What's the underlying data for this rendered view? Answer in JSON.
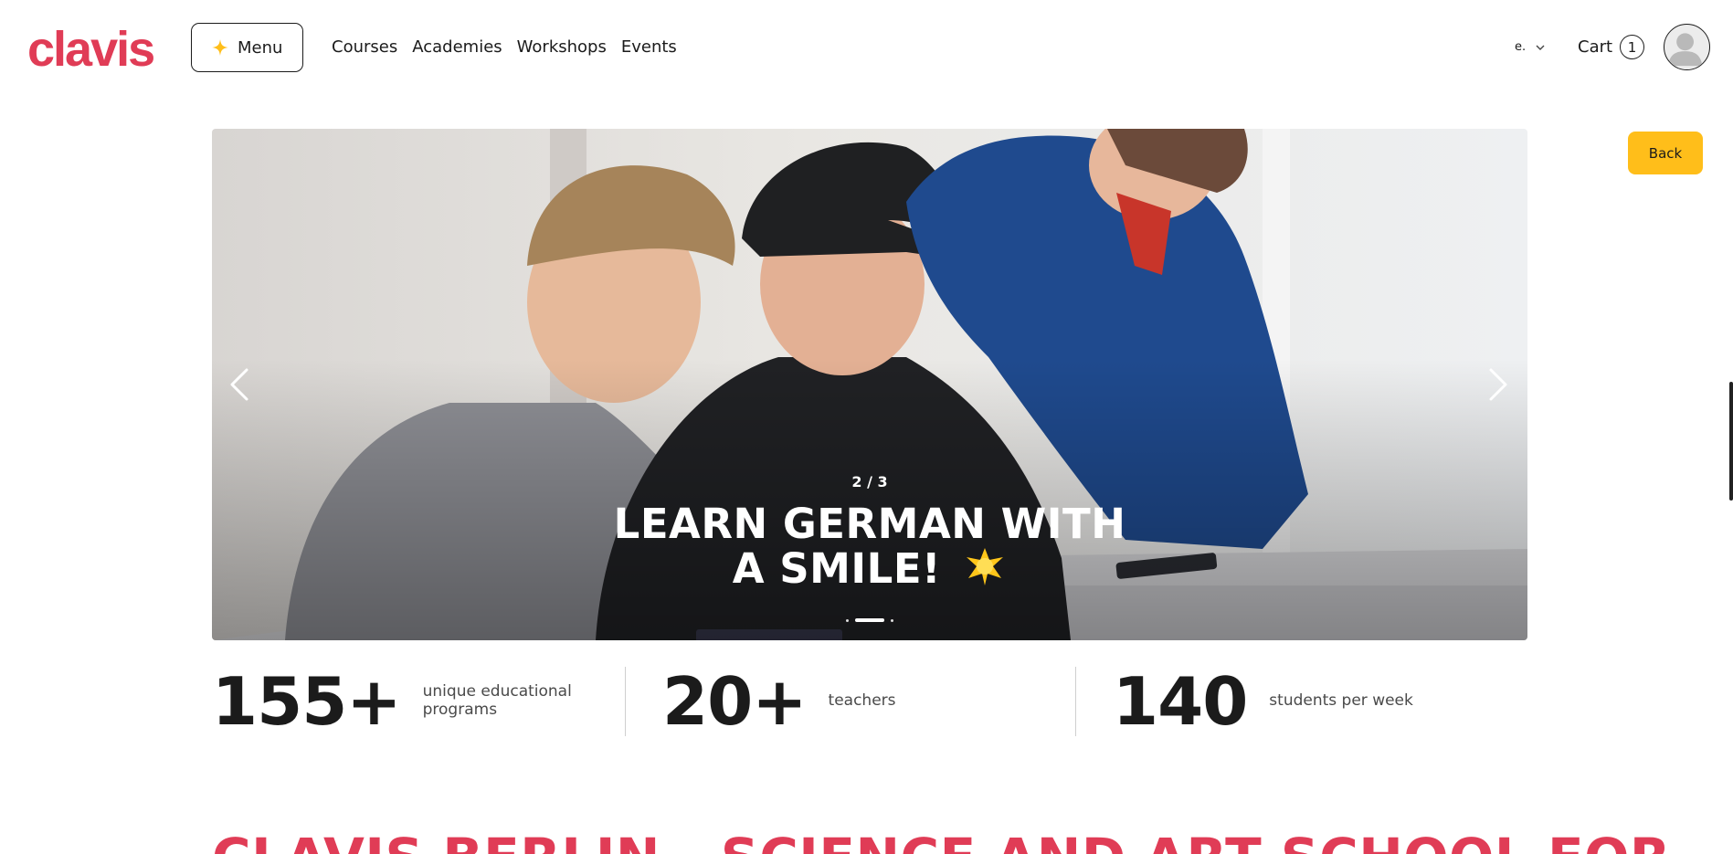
{
  "brand": {
    "logo_text": "clavis",
    "accent": "#e03c56",
    "highlight": "#ffbe1a"
  },
  "header": {
    "menu_label": "Menu",
    "nav": [
      "Courses",
      "Academies",
      "Workshops",
      "Events"
    ],
    "language": "e.",
    "cart_label": "Cart",
    "cart_count": "1"
  },
  "hero": {
    "counter": "2 / 3",
    "headline": "LEARN GERMAN WITH A SMILE!",
    "emoji_icon": "glowing-star-icon",
    "slides_total": 3,
    "active_slide": 2
  },
  "back_label": "Back",
  "stats": [
    {
      "value": "155+",
      "label": "unique educational programs"
    },
    {
      "value": "20+",
      "label": "teachers"
    },
    {
      "value": "140",
      "label": "students per week"
    }
  ],
  "section_title": "CLAVIS BERLIN - SCIENCE AND ART SCHOOL FOR"
}
